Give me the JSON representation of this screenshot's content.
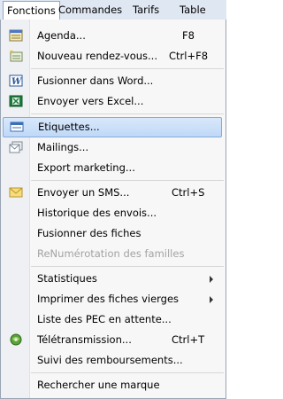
{
  "menubar": {
    "tabs": [
      {
        "label": "Fonctions"
      },
      {
        "label": "Commandes"
      },
      {
        "label": "Tarifs"
      },
      {
        "label": "Table"
      }
    ]
  },
  "menu": {
    "items": [
      {
        "label": "Agenda...",
        "shortcut": "F8",
        "icon": "calendar-icon"
      },
      {
        "label": "Nouveau rendez-vous...",
        "shortcut": "Ctrl+F8",
        "icon": "new-appointment-icon"
      },
      {
        "label": "Fusionner dans Word...",
        "icon": "word-icon"
      },
      {
        "label": "Envoyer vers Excel...",
        "icon": "excel-icon"
      },
      {
        "label": "Etiquettes...",
        "icon": "labels-icon",
        "selected": true
      },
      {
        "label": "Mailings...",
        "icon": "mailings-icon"
      },
      {
        "label": "Export marketing..."
      },
      {
        "label": "Envoyer un SMS...",
        "shortcut": "Ctrl+S",
        "icon": "envelope-icon"
      },
      {
        "label": "Historique des envois..."
      },
      {
        "label": "Fusionner des fiches"
      },
      {
        "label": "ReNumérotation des familles",
        "disabled": true
      },
      {
        "label": "Statistiques",
        "submenu": true
      },
      {
        "label": "Imprimer des fiches vierges",
        "submenu": true
      },
      {
        "label": "Liste des PEC en attente..."
      },
      {
        "label": "Télétransmission...",
        "shortcut": "Ctrl+T",
        "icon": "teletransmission-icon"
      },
      {
        "label": "Suivi des remboursements..."
      },
      {
        "label": "Rechercher une marque"
      }
    ]
  },
  "colors": {
    "menubar_bg": "#dfe7f3",
    "selection_bg": "#c8ddf8",
    "selection_border": "#84acdd",
    "disabled_text": "#a3a3a3"
  }
}
